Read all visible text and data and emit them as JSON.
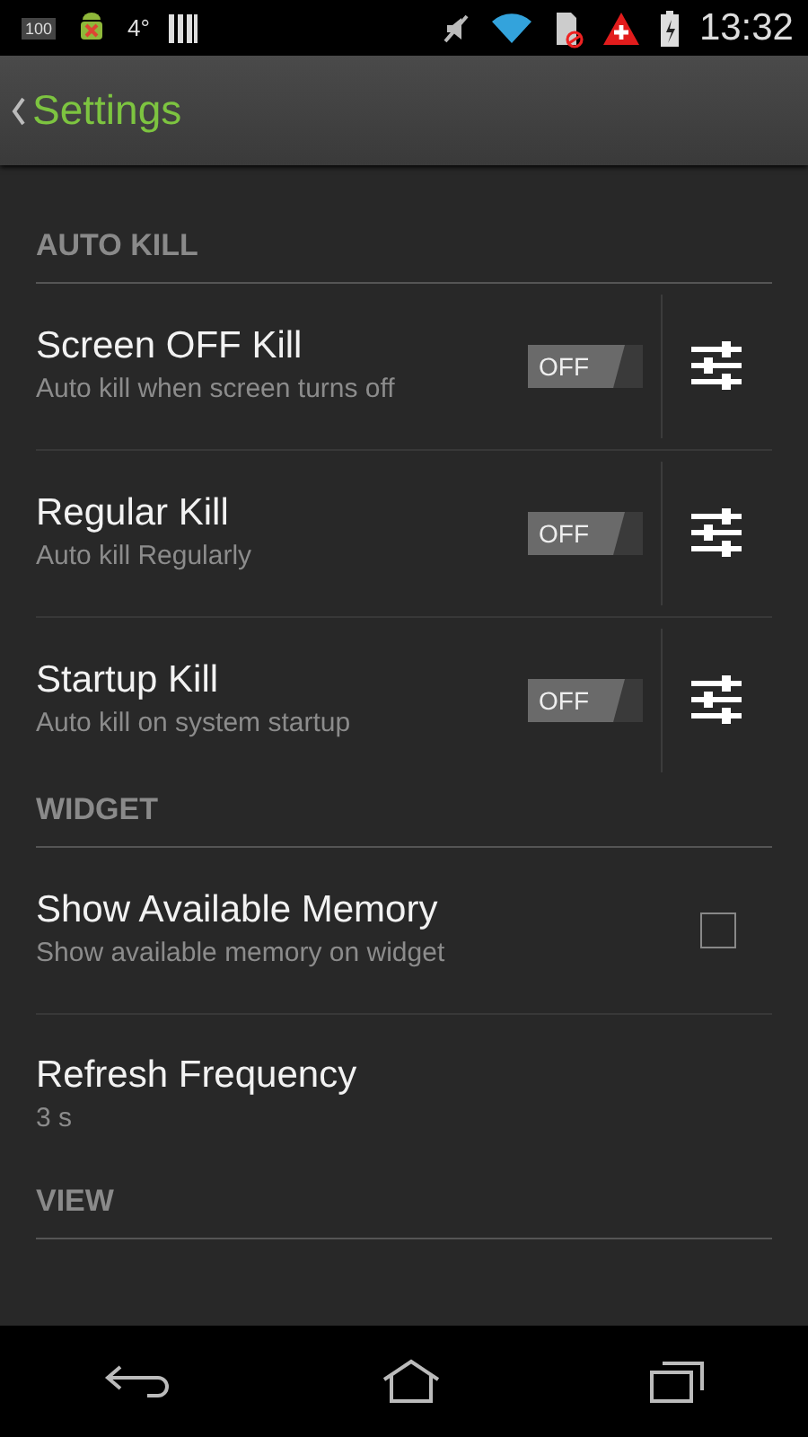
{
  "status_bar": {
    "battery_text": "100",
    "temperature": "4°",
    "time": "13:32"
  },
  "action_bar": {
    "title": "Settings"
  },
  "sections": [
    {
      "header": "AUTO KILL",
      "items": [
        {
          "kind": "toggle",
          "title": "Screen OFF Kill",
          "subtitle": "Auto kill when screen turns off",
          "on": false,
          "toggle_label": "OFF"
        },
        {
          "kind": "toggle",
          "title": "Regular Kill",
          "subtitle": "Auto kill Regularly",
          "on": false,
          "toggle_label": "OFF"
        },
        {
          "kind": "toggle",
          "title": "Startup Kill",
          "subtitle": "Auto kill on system startup",
          "on": false,
          "toggle_label": "OFF"
        }
      ]
    },
    {
      "header": "WIDGET",
      "items": [
        {
          "kind": "checkbox",
          "title": "Show Available Memory",
          "subtitle": "Show available memory on widget",
          "checked": false
        },
        {
          "kind": "value",
          "title": "Refresh Frequency",
          "subtitle": "3 s"
        }
      ]
    },
    {
      "header": "VIEW"
    }
  ]
}
